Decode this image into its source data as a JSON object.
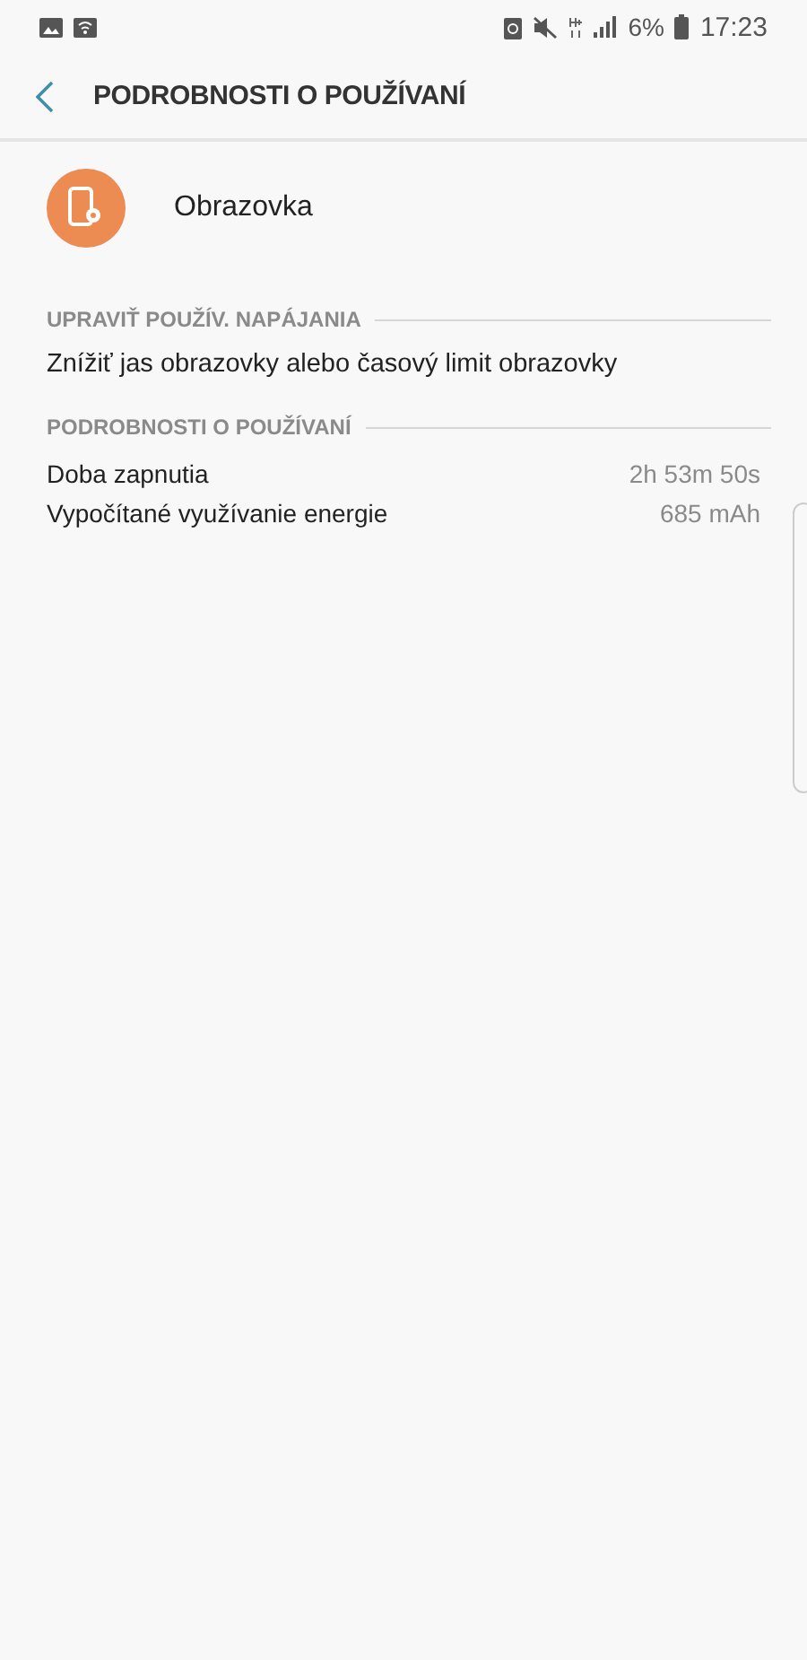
{
  "status_bar": {
    "battery_percent": "6%",
    "time": "17:23"
  },
  "header": {
    "title": "PODROBNOSTI O POUŽÍVANÍ"
  },
  "app": {
    "name": "Obrazovka"
  },
  "sections": [
    {
      "title": "UPRAVIŤ POUŽÍV. NAPÁJANIA",
      "rows": [
        {
          "kind": "action",
          "label": "Znížiť jas obrazovky alebo časový limit obrazovky"
        }
      ]
    },
    {
      "title": "PODROBNOSTI O POUŽÍVANÍ",
      "rows": [
        {
          "kind": "detail",
          "label": "Doba zapnutia",
          "value": "2h 53m 50s"
        },
        {
          "kind": "detail",
          "label": "Vypočítané využívanie energie",
          "value": "685 mAh"
        }
      ]
    }
  ]
}
